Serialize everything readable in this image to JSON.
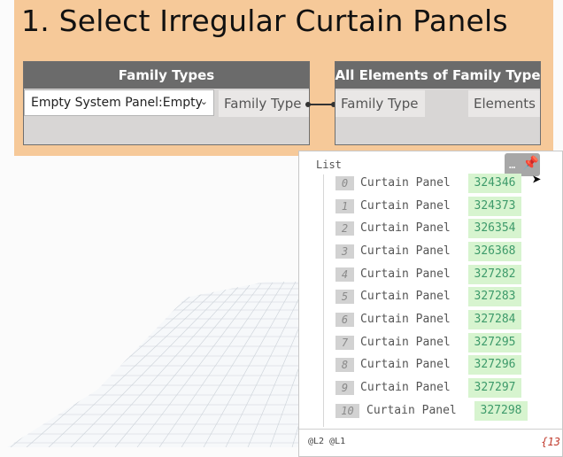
{
  "group": {
    "title": "1. Select Irregular Curtain Panels",
    "color": "#f6c999"
  },
  "node_family_types": {
    "title": "Family Types",
    "dropdown_value": "Empty System Panel:Empty",
    "output_port": "Family Type"
  },
  "node_all_elements": {
    "title": "All Elements of Family Type",
    "input_port": "Family Type",
    "output_port": "Elements"
  },
  "preview": {
    "header": "List",
    "items": [
      {
        "index": "0",
        "name": "Curtain Panel",
        "id": "324346"
      },
      {
        "index": "1",
        "name": "Curtain Panel",
        "id": "324373"
      },
      {
        "index": "2",
        "name": "Curtain Panel",
        "id": "326354"
      },
      {
        "index": "3",
        "name": "Curtain Panel",
        "id": "326368"
      },
      {
        "index": "4",
        "name": "Curtain Panel",
        "id": "327282"
      },
      {
        "index": "5",
        "name": "Curtain Panel",
        "id": "327283"
      },
      {
        "index": "6",
        "name": "Curtain Panel",
        "id": "327284"
      },
      {
        "index": "7",
        "name": "Curtain Panel",
        "id": "327295"
      },
      {
        "index": "8",
        "name": "Curtain Panel",
        "id": "327296"
      },
      {
        "index": "9",
        "name": "Curtain Panel",
        "id": "327297"
      },
      {
        "index": "10",
        "name": "Curtain Panel",
        "id": "327298"
      }
    ],
    "levels": "@L2 @L1",
    "count": "{13",
    "pin_button": "…"
  }
}
